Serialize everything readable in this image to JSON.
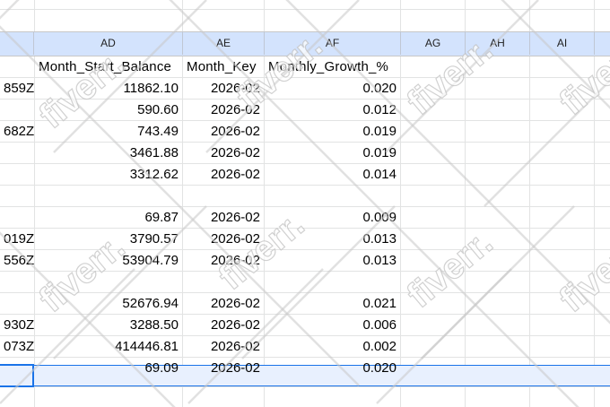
{
  "columns": [
    "AD",
    "AE",
    "AF",
    "AG",
    "AH",
    "AI"
  ],
  "header_row": {
    "ad": "Month_Start_Balance",
    "ae": "Month_Key",
    "af": "Monthly_Growth_%"
  },
  "rows": [
    {
      "left": "859Z",
      "ad": "11862.10",
      "ae": "2026-02",
      "af": "0.020"
    },
    {
      "left": "",
      "ad": "590.60",
      "ae": "2026-02",
      "af": "0.012"
    },
    {
      "left": "682Z",
      "ad": "743.49",
      "ae": "2026-02",
      "af": "0.019"
    },
    {
      "left": "",
      "ad": "3461.88",
      "ae": "2026-02",
      "af": "0.019"
    },
    {
      "left": "",
      "ad": "3312.62",
      "ae": "2026-02",
      "af": "0.014"
    },
    {
      "left": "",
      "ad": "",
      "ae": "",
      "af": ""
    },
    {
      "left": "",
      "ad": "69.87",
      "ae": "2026-02",
      "af": "0.009"
    },
    {
      "left": "019Z",
      "ad": "3790.57",
      "ae": "2026-02",
      "af": "0.013"
    },
    {
      "left": "556Z",
      "ad": "53904.79",
      "ae": "2026-02",
      "af": "0.013"
    },
    {
      "left": "",
      "ad": "",
      "ae": "",
      "af": ""
    },
    {
      "left": "",
      "ad": "52676.94",
      "ae": "2026-02",
      "af": "0.021"
    },
    {
      "left": "930Z",
      "ad": "3288.50",
      "ae": "2026-02",
      "af": "0.006"
    },
    {
      "left": "073Z",
      "ad": "414446.81",
      "ae": "2026-02",
      "af": "0.002"
    },
    {
      "left": "",
      "ad": "69.09",
      "ae": "2026-02",
      "af": "0.020"
    }
  ],
  "watermark_text": "fiverr.",
  "colors": {
    "header_bg": "#d3e3fd",
    "selection_border": "#1a73e8",
    "selection_fill": "#e8f0fe",
    "gridline": "#e2e3e3"
  }
}
